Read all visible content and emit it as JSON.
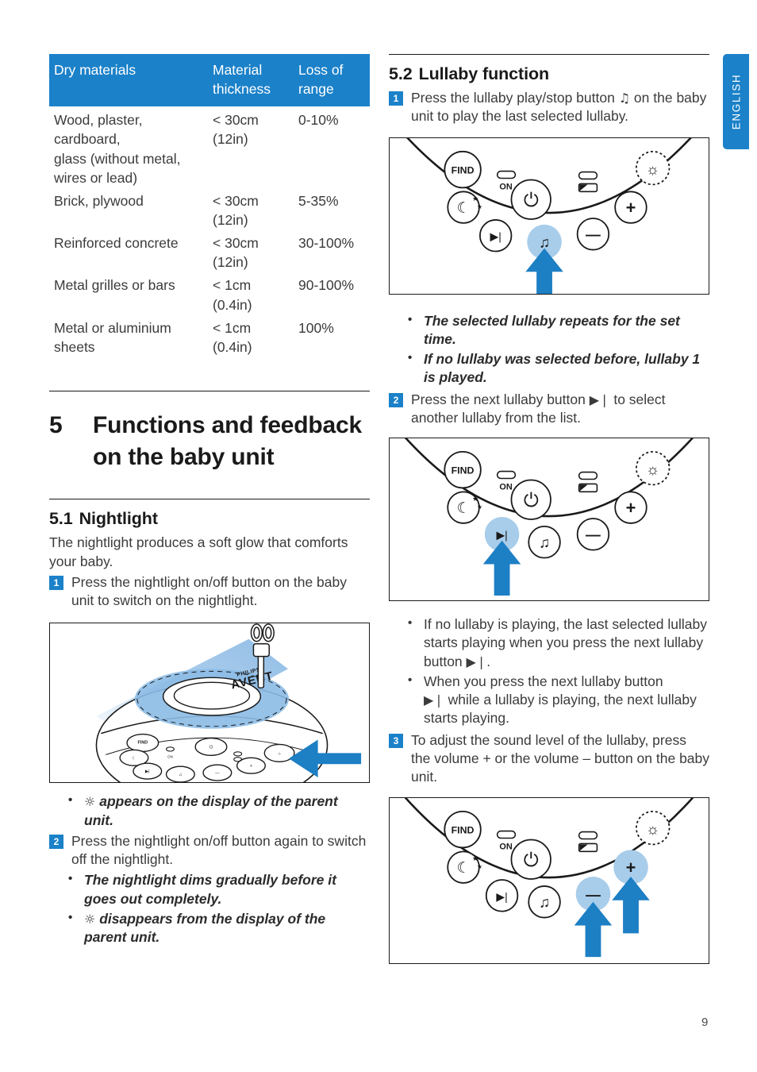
{
  "language_tab": {
    "label": "ENGLISH"
  },
  "page_number": "9",
  "colors": {
    "accent": "#1b81c9",
    "button_highlight": "#a8cdeb",
    "arrow": "#1d7fc4",
    "text": "#3b3b3b"
  },
  "table": {
    "headers": [
      "Dry materials",
      "Material thickness",
      "Loss of range"
    ],
    "headers_wrapped": [
      {
        "line1": "Dry materials",
        "line2": ""
      },
      {
        "line1": "Material",
        "line2": "thickness"
      },
      {
        "line1": "Loss of",
        "line2": "range"
      }
    ],
    "rows": [
      {
        "material": "Wood, plaster, cardboard, glass (without metal, wires or lead)",
        "thickness": "< 30cm (12in)",
        "loss": "0-10%"
      },
      {
        "material": "Brick, plywood",
        "thickness": "< 30cm (12in)",
        "loss": "5-35%"
      },
      {
        "material": "Reinforced concrete",
        "thickness": "< 30cm (12in)",
        "loss": "30-100%"
      },
      {
        "material": "Metal grilles or bars",
        "thickness": "< 1cm (0.4in)",
        "loss": "90-100%"
      },
      {
        "material": "Metal or aluminium sheets",
        "thickness": "< 1cm (0.4in)",
        "loss": "100%"
      }
    ]
  },
  "chapter": {
    "number": "5",
    "title": "Functions and feedback on the baby unit"
  },
  "section_51": {
    "number": "5.1",
    "title": "Nightlight",
    "intro": "The nightlight produces a soft glow that comforts your baby.",
    "step1": {
      "badge": "1",
      "text": "Press the nightlight on/off button on the baby unit to switch on the nightlight."
    },
    "bullet_after_fig": "appears on the display of the parent unit.",
    "bullet_after_fig_icon": "nightlight-symbol",
    "step2": {
      "badge": "2",
      "text": "Press the nightlight on/off button again to switch off the nightlight."
    },
    "step2_bullets": [
      {
        "icon": "",
        "text": "The nightlight dims gradually before it goes out completely."
      },
      {
        "icon": "nightlight-symbol",
        "text": "disappears from the display of the parent unit."
      }
    ],
    "figure": {
      "name": "baby-unit-nightlight-illustration",
      "brand_line1": "PHILIPS",
      "brand_line2": "AVENT",
      "arrow_points_to": "nightlight-on-off-button"
    }
  },
  "section_52": {
    "number": "5.2",
    "title": "Lullaby function",
    "step1": {
      "badge": "1",
      "text_before": "Press the lullaby play/stop button",
      "icon": "♫",
      "text_after": "on the baby unit to play the last selected lullaby."
    },
    "step1_bullets": [
      "The selected lullaby repeats for the set time.",
      "If no lullaby was selected before, lullaby 1 is played."
    ],
    "step2": {
      "badge": "2",
      "text_before": "Press the next lullaby button",
      "icon": "▶❘",
      "text_after": "to select another lullaby from the list."
    },
    "step2_bullets": [
      {
        "text_before": "If no lullaby is playing, the last selected lullaby starts playing when you press the next lullaby button",
        "icon": "▶❘",
        "text_after": "."
      },
      {
        "text_before": "When you press the next lullaby button",
        "icon": "▶❘",
        "text_after": "while a lullaby is playing, the next lullaby starts playing."
      }
    ],
    "step3": {
      "badge": "3",
      "text": "To adjust the sound level of the lullaby, press the volume + or the volume – button on the baby unit."
    }
  },
  "control_panel": {
    "buttons": [
      {
        "name": "find-button",
        "label": "FIND"
      },
      {
        "name": "nightlight-button",
        "label": "moon-stars"
      },
      {
        "name": "next-lullaby-button",
        "label": "▶❘"
      },
      {
        "name": "lullaby-play-stop-button",
        "label": "♫"
      },
      {
        "name": "volume-minus-button",
        "label": "−"
      },
      {
        "name": "volume-plus-button",
        "label": "+"
      },
      {
        "name": "power-button",
        "label": "power-symbol"
      },
      {
        "name": "link-light-button",
        "label": "lamp-symbol"
      }
    ],
    "indicators": [
      {
        "name": "on-led-indicator",
        "label": "ON"
      },
      {
        "name": "battery-indicator",
        "label": ""
      }
    ],
    "figures": [
      {
        "name": "lullaby-play-stop-diagram",
        "highlighted": [
          "lullaby-play-stop-button"
        ]
      },
      {
        "name": "next-lullaby-diagram",
        "highlighted": [
          "next-lullaby-button"
        ]
      },
      {
        "name": "volume-diagram",
        "highlighted": [
          "volume-minus-button",
          "volume-plus-button"
        ]
      }
    ]
  }
}
